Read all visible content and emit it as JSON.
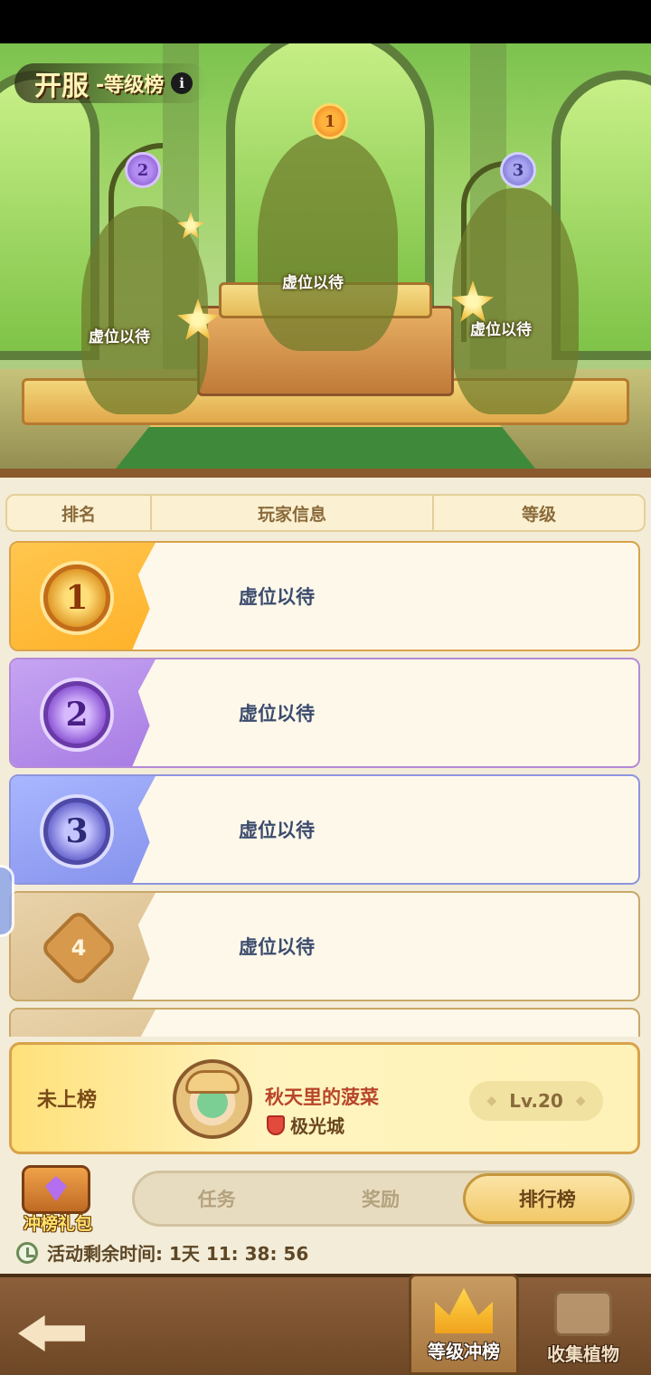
{
  "scene": {
    "title_main": "开服",
    "title_sub": "-等级榜",
    "info_icon": "info-icon",
    "podium": [
      {
        "rank": "1",
        "label": "虚位以待"
      },
      {
        "rank": "2",
        "label": "虚位以待"
      },
      {
        "rank": "3",
        "label": "虚位以待"
      }
    ]
  },
  "table": {
    "headers": {
      "rank": "排名",
      "player": "玩家信息",
      "level": "等级"
    },
    "rows": [
      {
        "rank": "1",
        "name": "虚位以待"
      },
      {
        "rank": "2",
        "name": "虚位以待"
      },
      {
        "rank": "3",
        "name": "虚位以待"
      },
      {
        "rank": "4",
        "name": "虚位以待"
      }
    ]
  },
  "my_rank": {
    "status": "未上榜",
    "name": "秋天里的菠菜",
    "server": "极光城",
    "level": "Lv.20"
  },
  "gift": {
    "label": "冲榜礼包"
  },
  "tabs": [
    {
      "label": "任务",
      "active": false
    },
    {
      "label": "奖励",
      "active": false
    },
    {
      "label": "排行榜",
      "active": true
    }
  ],
  "timer": {
    "text": "活动剩余时间: 1天 11: 38: 56"
  },
  "bottom_nav": {
    "rank_label": "等级冲榜",
    "collect_label": "收集植物"
  },
  "colors": {
    "gold": "#ffb22a",
    "purple": "#a77ce4",
    "blue": "#8592ec",
    "name_red": "#b8452a",
    "brown": "#6e4726"
  }
}
